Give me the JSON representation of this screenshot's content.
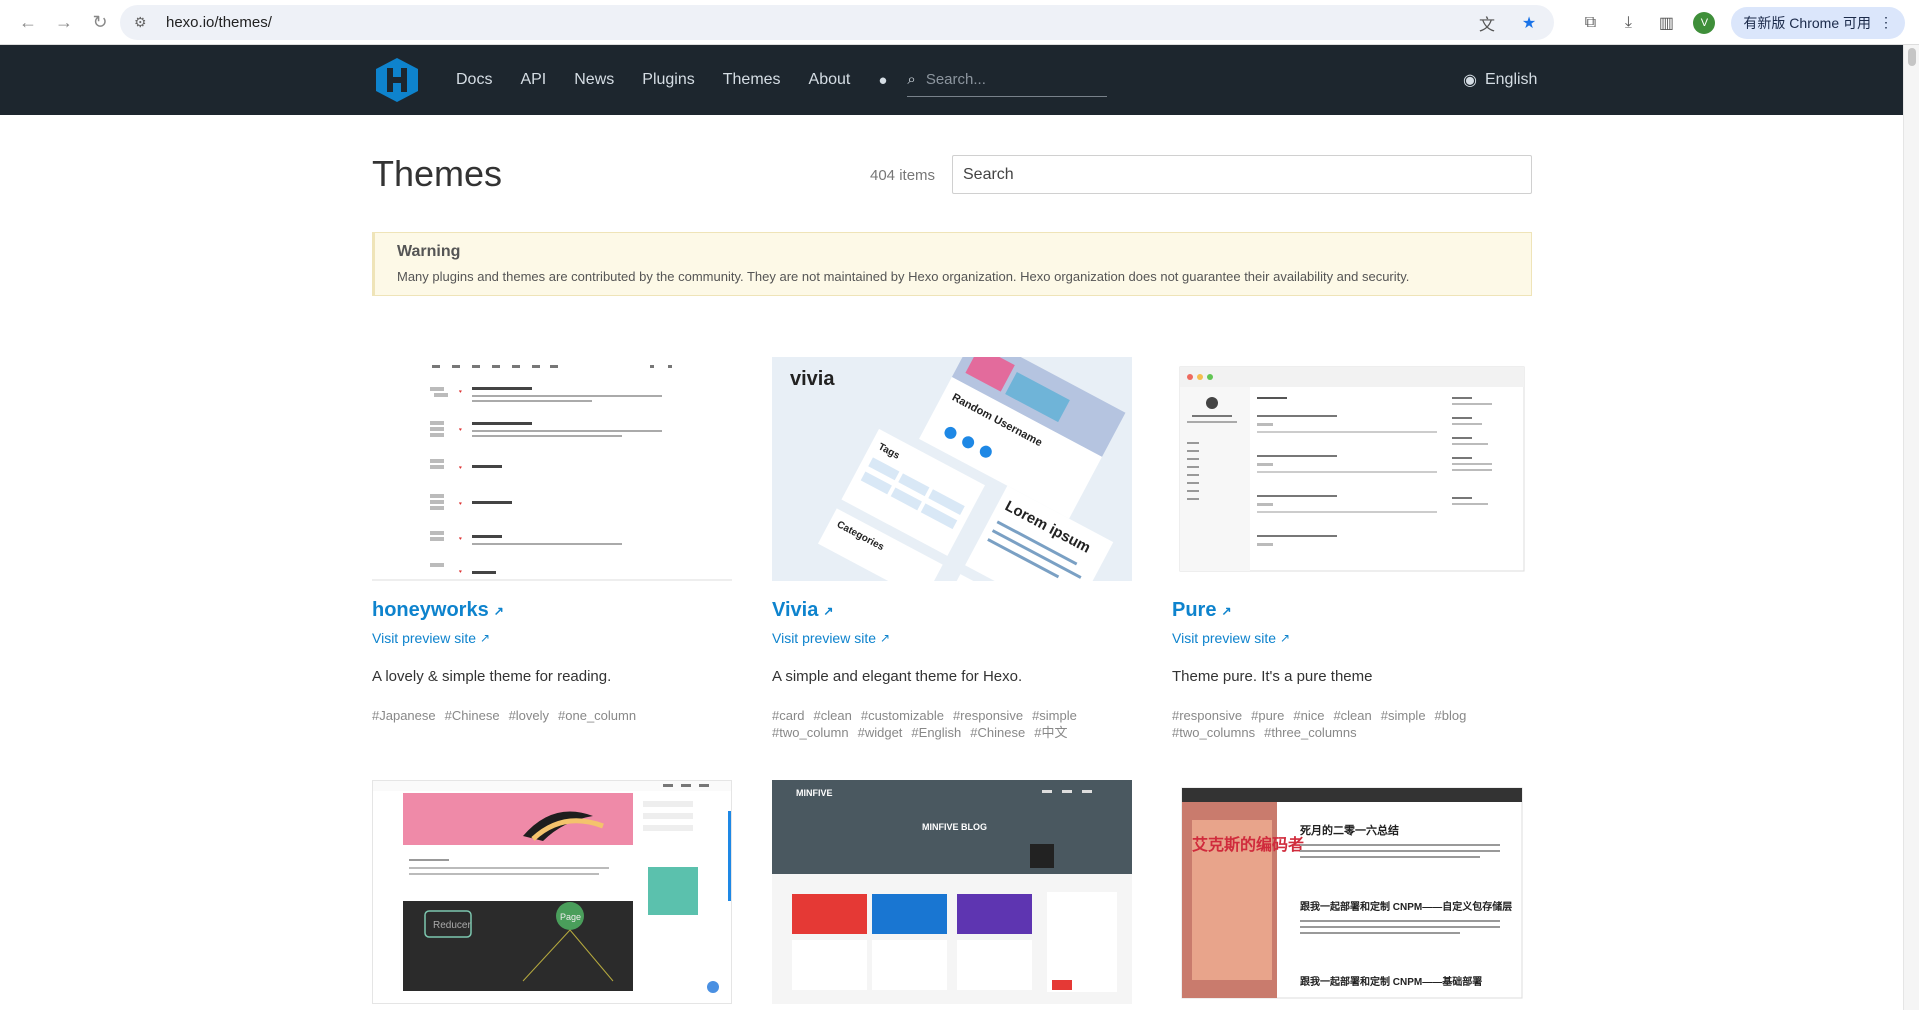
{
  "browser": {
    "url": "hexo.io/themes/",
    "profile_initial": "V",
    "update_label": "有新版 Chrome 可用"
  },
  "site": {
    "nav": [
      "Docs",
      "API",
      "News",
      "Plugins",
      "Themes",
      "About"
    ],
    "search_placeholder": "Search...",
    "language": "English"
  },
  "page": {
    "title": "Themes",
    "count": "404 items",
    "search_placeholder": "Search"
  },
  "warning": {
    "title": "Warning",
    "body": "Many plugins and themes are contributed by the community. They are not maintained by Hexo organization. Hexo organization does not guarantee their availability and security."
  },
  "themes": [
    {
      "name": "honeyworks",
      "preview_label": "Visit preview site",
      "description": "A lovely & simple theme for reading.",
      "tags": [
        "#Japanese",
        "#Chinese",
        "#lovely",
        "#one_column"
      ]
    },
    {
      "name": "Vivia",
      "preview_label": "Visit preview site",
      "description": "A simple and elegant theme for Hexo.",
      "tags": [
        "#card",
        "#clean",
        "#customizable",
        "#responsive",
        "#simple",
        "#two_column",
        "#widget",
        "#English",
        "#Chinese",
        "#中文"
      ],
      "thumb_text": {
        "logo": "vivia",
        "username": "Random Username",
        "tags_heading": "Tags",
        "categories_heading": "Categories",
        "lorem": "Lorem ipsum"
      }
    },
    {
      "name": "Pure",
      "preview_label": "Visit preview site",
      "description": "Theme pure. It's a pure theme",
      "tags": [
        "#responsive",
        "#pure",
        "#nice",
        "#clean",
        "#simple",
        "#blog",
        "#two_columns",
        "#three_columns"
      ]
    }
  ],
  "second_row": {
    "minfive": {
      "brand": "MINFIVE",
      "blog_title": "MINFIVE BLOG"
    },
    "reducer_label": "Reducer",
    "page_label": "Page",
    "cn_titles": [
      "死月的二零一六总结",
      "跟我一起部署和定制 CNPM——自定义包存储层",
      "跟我一起部署和定制 CNPM——基础部署"
    ],
    "cn_banner": "艾克斯的编码者"
  },
  "colors": {
    "accent": "#0e83cd",
    "header_bg": "#1d262e"
  }
}
